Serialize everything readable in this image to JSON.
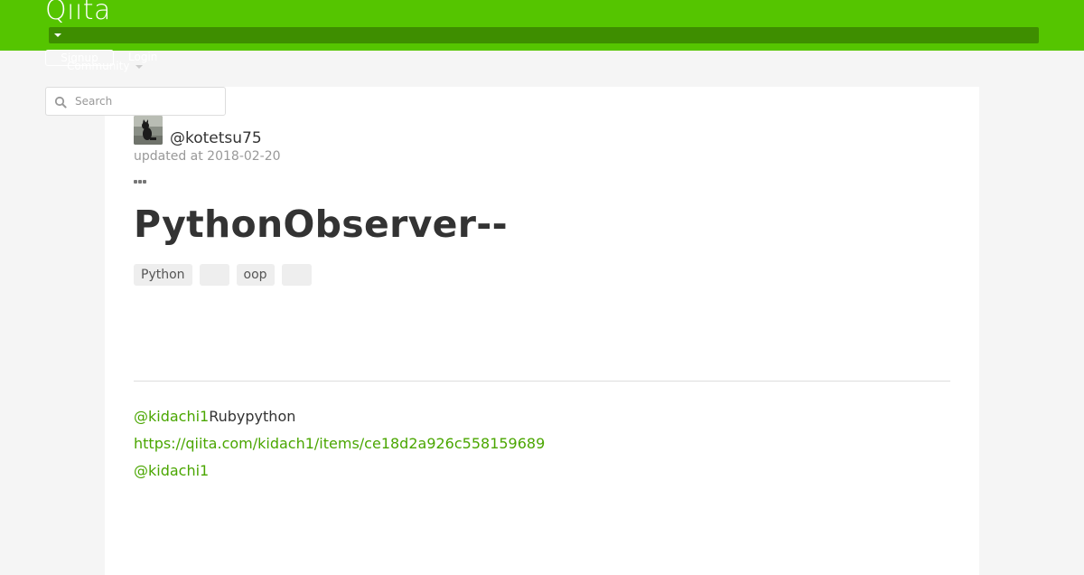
{
  "header": {
    "logo": "Qiita",
    "signup_label": "Signup",
    "login_label": "Login",
    "community_label": "Community",
    "brand_color": "#55c500"
  },
  "search": {
    "placeholder": "Search"
  },
  "article": {
    "author": "@kotetsu75",
    "updated_at": "updated at 2018-02-20",
    "title": "PythonObserver--",
    "tags": [
      "Python",
      "",
      "oop",
      ""
    ],
    "body": {
      "line1_mention": "@kidachi1",
      "line1_text": "Rubypython",
      "line2_link": "https://qiita.com/kidach1/items/ce18d2a926c558159689",
      "line3_mention": "@kidachi1"
    },
    "link_color": "#4aa600"
  }
}
